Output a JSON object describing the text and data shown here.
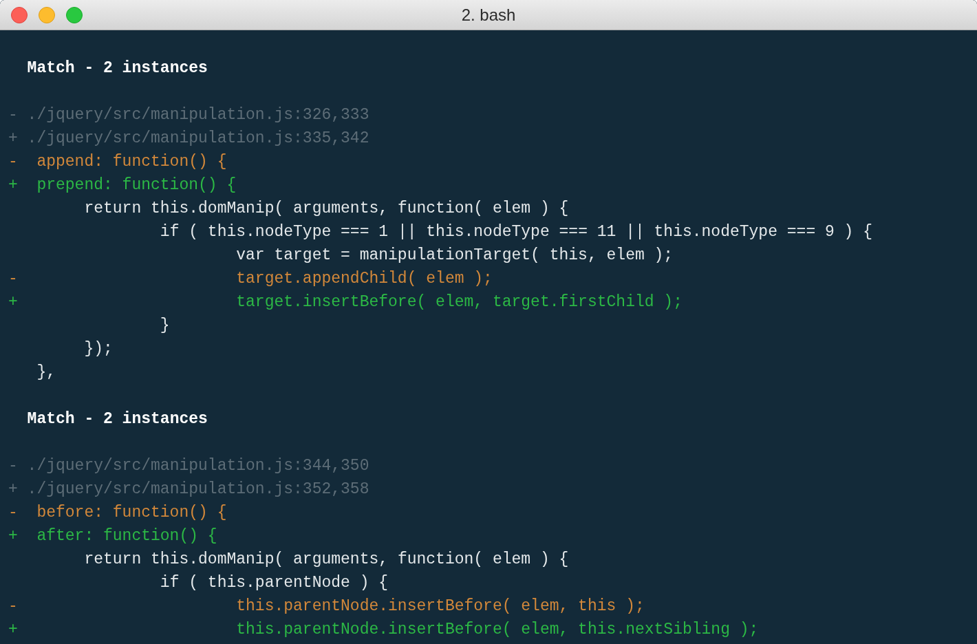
{
  "window": {
    "title": "2. bash"
  },
  "lines": [
    {
      "kind": "blank"
    },
    {
      "kind": "heading",
      "text": " Match - 2 instances"
    },
    {
      "kind": "blank"
    },
    {
      "kind": "path",
      "marker": "-",
      "text": " ./jquery/src/manipulation.js:326,333"
    },
    {
      "kind": "path",
      "marker": "+",
      "text": " ./jquery/src/manipulation.js:335,342"
    },
    {
      "kind": "removed",
      "marker": "-",
      "text": "  append: function() {"
    },
    {
      "kind": "added",
      "marker": "+",
      "text": "  prepend: function() {"
    },
    {
      "kind": "context",
      "text": "       return this.domManip( arguments, function( elem ) {"
    },
    {
      "kind": "context",
      "text": "               if ( this.nodeType === 1 || this.nodeType === 11 || this.nodeType === 9 ) {"
    },
    {
      "kind": "context",
      "text": "                       var target = manipulationTarget( this, elem );"
    },
    {
      "kind": "removed",
      "marker": "-",
      "text": "                       target.appendChild( elem );"
    },
    {
      "kind": "added",
      "marker": "+",
      "text": "                       target.insertBefore( elem, target.firstChild );"
    },
    {
      "kind": "context",
      "text": "               }"
    },
    {
      "kind": "context",
      "text": "       });"
    },
    {
      "kind": "context",
      "text": "  },"
    },
    {
      "kind": "blank"
    },
    {
      "kind": "heading",
      "text": " Match - 2 instances"
    },
    {
      "kind": "blank"
    },
    {
      "kind": "path",
      "marker": "-",
      "text": " ./jquery/src/manipulation.js:344,350"
    },
    {
      "kind": "path",
      "marker": "+",
      "text": " ./jquery/src/manipulation.js:352,358"
    },
    {
      "kind": "removed",
      "marker": "-",
      "text": "  before: function() {"
    },
    {
      "kind": "added",
      "marker": "+",
      "text": "  after: function() {"
    },
    {
      "kind": "context",
      "text": "       return this.domManip( arguments, function( elem ) {"
    },
    {
      "kind": "context",
      "text": "               if ( this.parentNode ) {"
    },
    {
      "kind": "removed",
      "marker": "-",
      "text": "                       this.parentNode.insertBefore( elem, this );"
    },
    {
      "kind": "added",
      "marker": "+",
      "text": "                       this.parentNode.insertBefore( elem, this.nextSibling );"
    }
  ]
}
